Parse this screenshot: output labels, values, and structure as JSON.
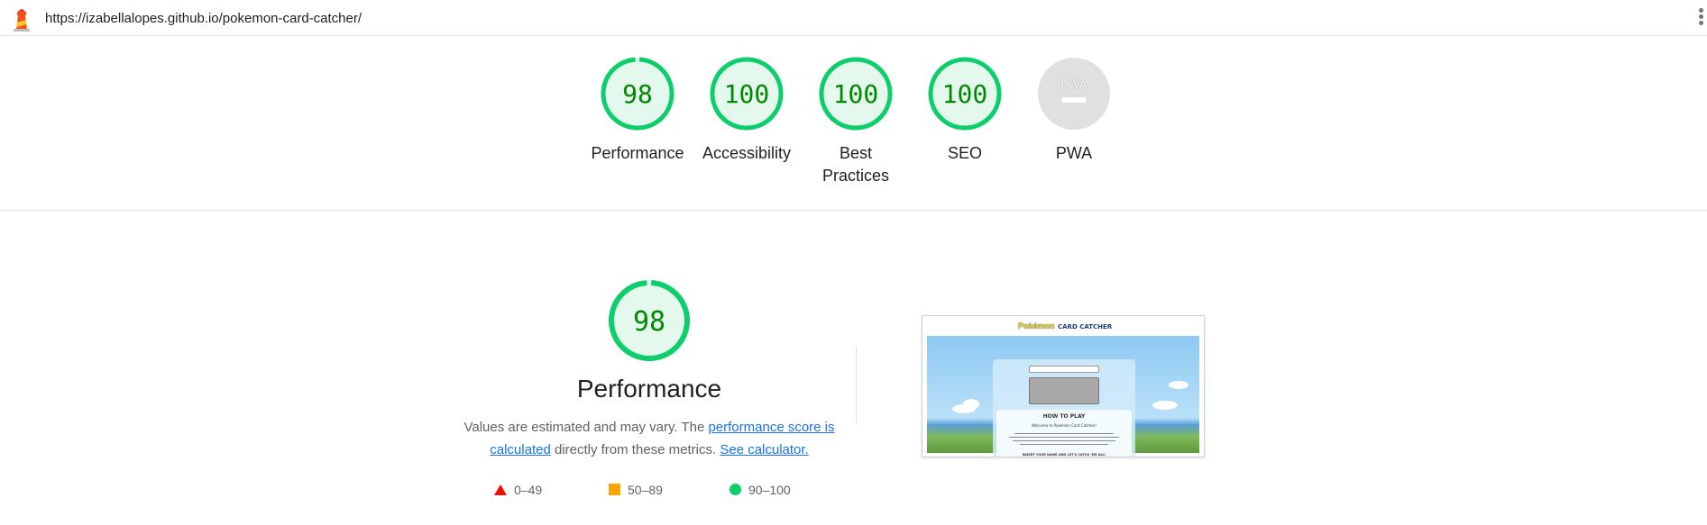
{
  "url": "https://izabellalopes.github.io/pokemon-card-catcher/",
  "colors": {
    "pass": "#0cce6b",
    "pass_text": "#008800",
    "average": "#ffa400",
    "fail": "#eb0f00",
    "link": "#1a73e8",
    "na_gray": "#e0e0e0"
  },
  "categories": [
    {
      "score": "98",
      "label": "Performance",
      "fraction": 0.98
    },
    {
      "score": "100",
      "label": "Accessibility",
      "fraction": 1.0
    },
    {
      "score": "100",
      "label": "Best Practices",
      "fraction": 1.0
    },
    {
      "score": "100",
      "label": "SEO",
      "fraction": 1.0
    },
    {
      "score": "",
      "label": "PWA",
      "icon": "pwa-badge-icon"
    }
  ],
  "performance": {
    "score": "98",
    "fraction": 0.98,
    "title": "Performance",
    "desc_prefix": "Values are estimated and may vary. The ",
    "link_score": "performance score is calculated",
    "desc_middle": " directly from these metrics. ",
    "link_calculator": "See calculator."
  },
  "legend": [
    {
      "range": "0–49",
      "shape": "triangle"
    },
    {
      "range": "50–89",
      "shape": "square"
    },
    {
      "range": "90–100",
      "shape": "circle"
    }
  ],
  "thumbnail": {
    "brand": "Pokémon",
    "title": "CARD CATCHER",
    "how_to_play": "HOW TO PLAY",
    "welcome": "Welcome to Pokemon Card Catcher!",
    "footer": "INSERT YOUR NAME AND LET'S CATCH 'EM ALL!"
  }
}
